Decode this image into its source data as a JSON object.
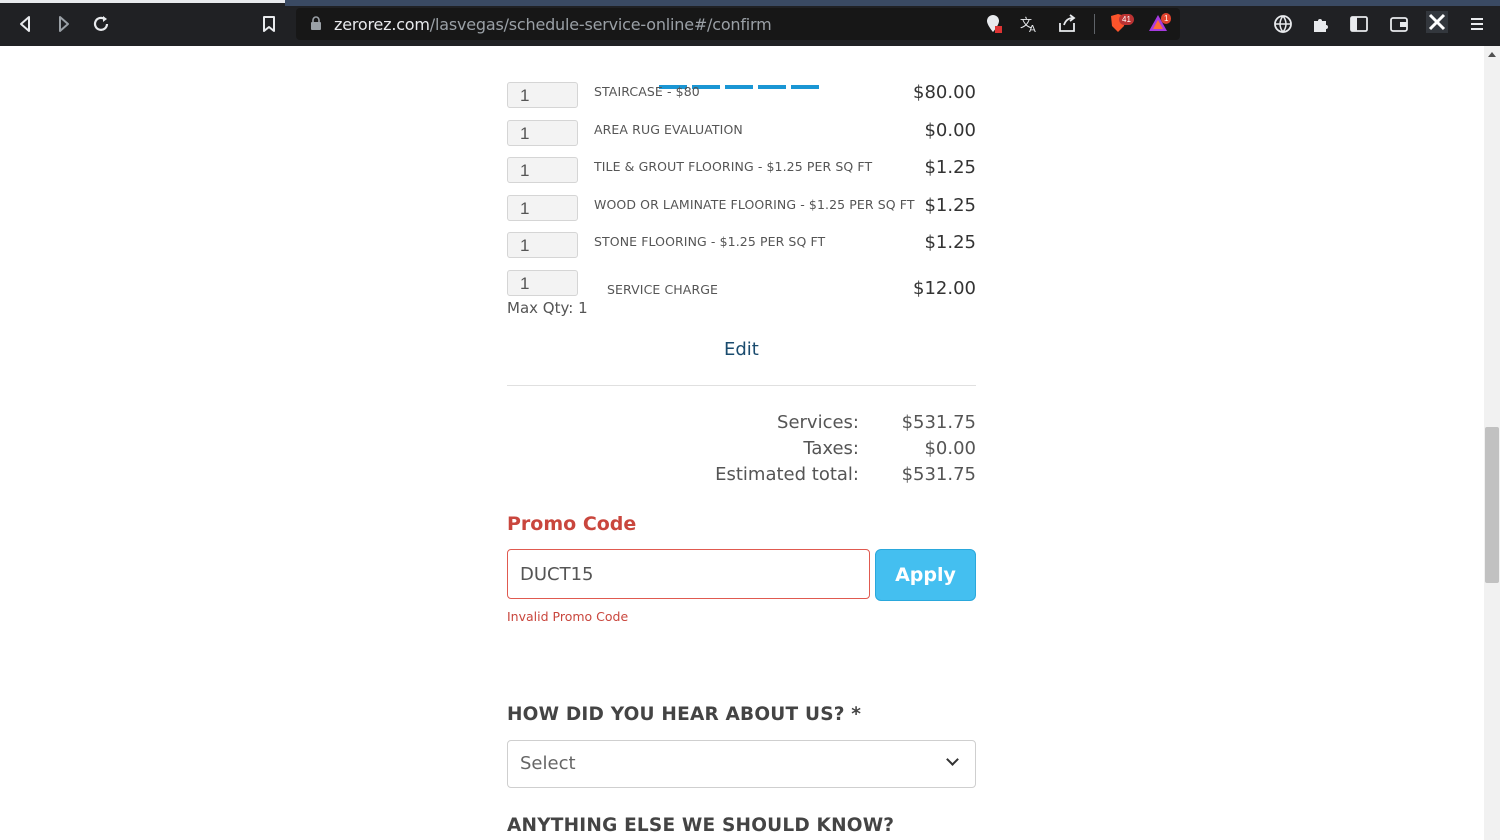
{
  "browser": {
    "url_host": "zerorez.com",
    "url_path": "/lasvegas/schedule-service-online#/confirm",
    "brave_badge": "41",
    "alert_badge": "1"
  },
  "line_items": [
    {
      "qty": "1",
      "label": "STAIRCASE - $80",
      "price": "$80.00"
    },
    {
      "qty": "1",
      "label": "AREA RUG EVALUATION",
      "price": "$0.00"
    },
    {
      "qty": "1",
      "label": "TILE & GROUT FLOORING - $1.25 PER SQ FT",
      "price": "$1.25"
    },
    {
      "qty": "1",
      "label": "WOOD OR LAMINATE FLOORING - $1.25 PER SQ FT",
      "price": "$1.25"
    },
    {
      "qty": "1",
      "label": "STONE FLOORING - $1.25 PER SQ FT",
      "price": "$1.25"
    },
    {
      "qty": "1",
      "label": "SERVICE CHARGE",
      "price": "$12.00"
    }
  ],
  "max_qty": "Max Qty: 1",
  "edit_label": "Edit",
  "totals": {
    "services_label": "Services:",
    "services_value": "$531.75",
    "taxes_label": "Taxes:",
    "taxes_value": "$0.00",
    "estimated_label": "Estimated total:",
    "estimated_value": "$531.75"
  },
  "promo": {
    "title": "Promo Code",
    "value": "DUCT15",
    "apply_label": "Apply",
    "error": "Invalid Promo Code"
  },
  "hear_about": {
    "label": "HOW DID YOU HEAR ABOUT US? *",
    "selected": "Select"
  },
  "anything_else": {
    "label": "ANYTHING ELSE WE SHOULD KNOW?"
  },
  "colors": {
    "accent_blue": "#44bff0",
    "error_red": "#c9463d",
    "progress_blue": "#1a96d4"
  }
}
